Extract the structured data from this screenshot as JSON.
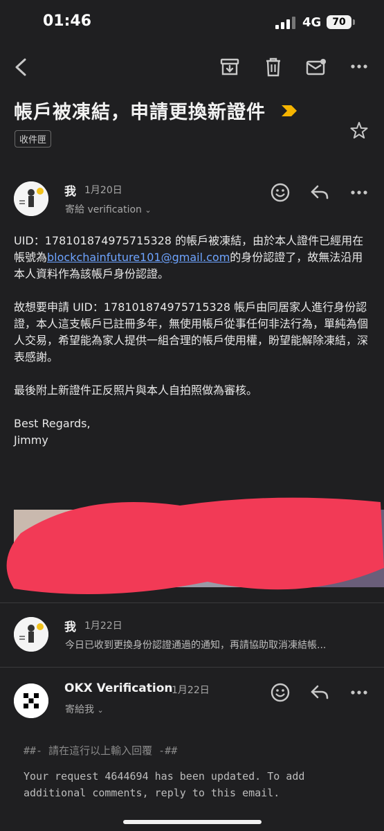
{
  "status_bar": {
    "time": "01:46",
    "network": "4G",
    "battery": "70"
  },
  "toolbar": {
    "icons": [
      "back-icon",
      "archive-icon",
      "delete-icon",
      "mark-unread-icon",
      "more-icon"
    ]
  },
  "email": {
    "subject": "帳戶被凍結，申請更換新證件",
    "label": "收件匣"
  },
  "messages": [
    {
      "sender": "我",
      "date": "1月20日",
      "to": "寄給 verification",
      "body": {
        "p1_before": "UID：178101874975715328 的帳戶被凍結，由於本人證件已經用在帳號為",
        "p1_link": "blockchainfuture101@gmail.com",
        "p1_after": "的身份認證了，故無法沿用本人資料作為該帳戶身份認證。",
        "p2": "故想要申請 UID：178101874975715328 帳戶由同居家人進行身份認證，本人這支帳戶已註冊多年，無使用帳戶從事任何非法行為，單純為個人交易，希望能為家人提供一組合理的帳戶使用權，盼望能解除凍結，深表感謝。",
        "p3": "最後附上新證件正反照片與本人自拍照做為審核。",
        "p4": "Best Regards,",
        "p5": "Jimmy"
      }
    },
    {
      "sender": "我",
      "date": "1月22日",
      "snippet": "今日已收到更換身份認證通過的通知，再請協助取消凍結帳..."
    },
    {
      "sender": "OKX Verification",
      "date": "1月22日",
      "to": "寄給我",
      "body": {
        "line1": "##- 請在這行以上輸入回覆 -##",
        "line2": "Your request 4644694 has been updated. To add additional comments, reply to this email."
      }
    }
  ]
}
